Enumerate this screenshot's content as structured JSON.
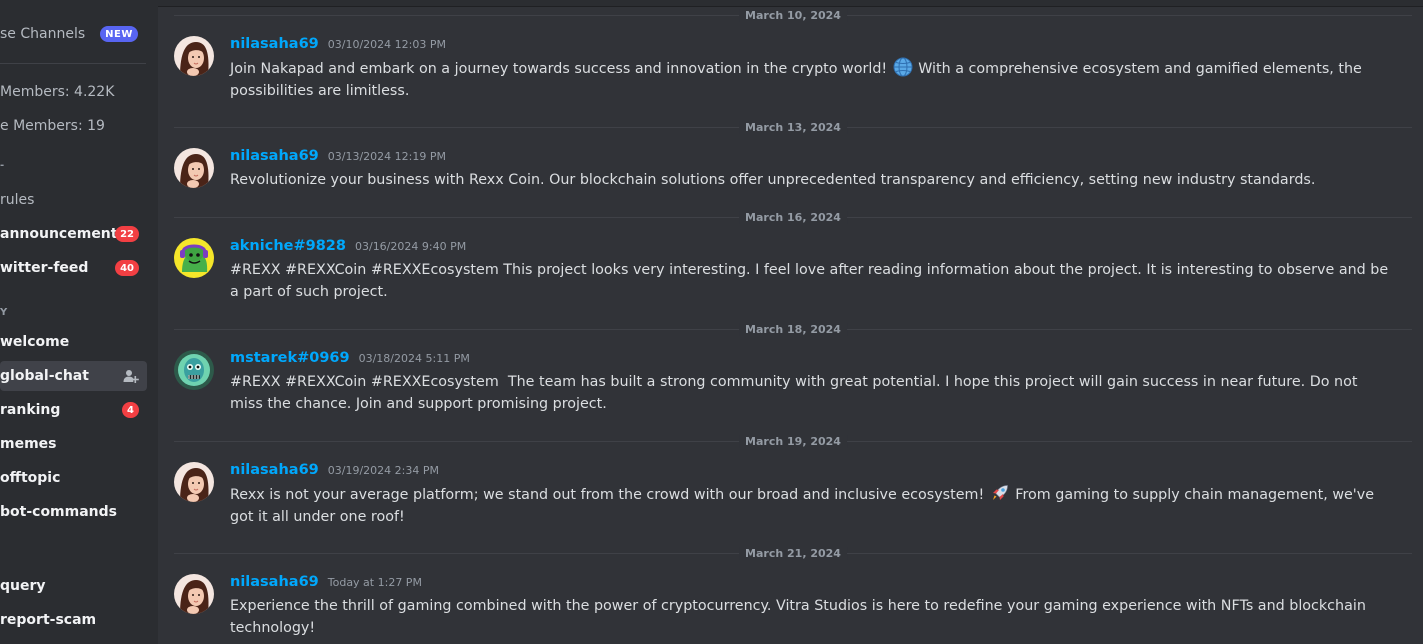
{
  "sidebar": {
    "browse_channels": "se Channels",
    "new_badge": "NEW",
    "members": "Members: 4.22K",
    "online_members": "e Members: 19",
    "category_1": "-",
    "category_2": "Y",
    "channels": [
      {
        "name": "rules",
        "badge": ""
      },
      {
        "name": "announcement",
        "badge": "22"
      },
      {
        "name": "witter-feed",
        "badge": "40"
      },
      {
        "name": "welcome",
        "badge": ""
      },
      {
        "name": "global-chat",
        "badge": ""
      },
      {
        "name": "ranking",
        "badge": "4"
      },
      {
        "name": "memes",
        "badge": ""
      },
      {
        "name": "offtopic",
        "badge": ""
      },
      {
        "name": "bot-commands",
        "badge": ""
      },
      {
        "name": "query",
        "badge": ""
      },
      {
        "name": "report-scam",
        "badge": ""
      }
    ]
  },
  "chat": {
    "dates": [
      "March 10, 2024",
      "March 13, 2024",
      "March 16, 2024",
      "March 18, 2024",
      "March 19, 2024",
      "March 21, 2024"
    ],
    "messages": [
      {
        "author": "nilasaha69",
        "timestamp": "03/10/2024 12:03 PM",
        "text_a": "Join Nakapad and embark on a journey towards success and innovation in the crypto world! ",
        "emoji": "globe-emoji",
        "text_b": " With a comprehensive ecosystem and gamified elements, the possibilities are limitless."
      },
      {
        "author": "nilasaha69",
        "timestamp": "03/13/2024 12:19 PM",
        "text_a": "Revolutionize your business with Rexx Coin. Our blockchain solutions offer unprecedented transparency and efficiency, setting new industry standards."
      },
      {
        "author": "akniche#9828",
        "timestamp": "03/16/2024 9:40 PM",
        "text_a": "#REXX #REXXCoin #REXXEcosystem This project looks very interesting. I feel love after reading information about the project. It is interesting to observe and be a part of such project."
      },
      {
        "author": "mstarek#0969",
        "timestamp": "03/18/2024 5:11 PM",
        "text_a": "#REXX #REXXCoin #REXXEcosystem  The team has built a strong community with great potential. I hope this project will gain success in near future. Do not miss the chance. Join and support promising project."
      },
      {
        "author": "nilasaha69",
        "timestamp": "03/19/2024 2:34 PM",
        "text_a": "Rexx is not your average platform; we stand out from the crowd with our broad and inclusive ecosystem! ",
        "emoji": "rocket-emoji",
        "text_b": " From gaming to supply chain management, we've got it all under one roof!"
      },
      {
        "author": "nilasaha69",
        "timestamp": "Today at 1:27 PM",
        "text_a": "Experience the thrill of gaming combined with the power of cryptocurrency. Vitra Studios is here to redefine your gaming experience with NFTs and blockchain technology!"
      }
    ]
  },
  "colors": {
    "background": "#313338",
    "sidebar": "#2b2d31",
    "author": "#00a8fc",
    "badge_red": "#f23f43",
    "badge_blue": "#5865f2"
  }
}
